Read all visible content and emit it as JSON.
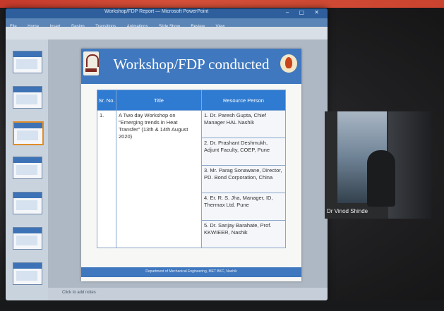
{
  "window": {
    "title_text": "Workshop/FDP Report — Microsoft PowerPoint",
    "ribbon_tabs": [
      "File",
      "Home",
      "Insert",
      "Design",
      "Transitions",
      "Animations",
      "Slide Show",
      "Review",
      "View"
    ],
    "controls": "–  ▢  ✕"
  },
  "slide": {
    "title": "Workshop/FDP conducted",
    "table": {
      "headers": [
        "Sr. No.",
        "Title",
        "Resource Person"
      ],
      "sr_no": "1.",
      "title_cell": "A Two day Workshop on \"Emerging trends in Heat Transfer\" (13th & 14th August 2020)",
      "resource_persons": [
        "1. Dr. Paresh Gupta, Chief Manager HAL Nashik",
        "2. Dr. Prashant Deshmukh, Adjunt Faculty, COEP, Pune",
        "3. Mr. Parag Sonawane, Director, PD. Bond Corporation, China",
        "4. Er. R. S. Jha, Manager, ID, Thermax Ltd. Pune",
        "5. Dr. Sanjay Barahate, Prof. KKWIEER, Nashik"
      ]
    },
    "footer": "Department of Mechanical Engineering, MET BKC, Nashik"
  },
  "status": {
    "notes_placeholder": "Click to add notes"
  },
  "participant": {
    "name": "Dr Vinod Shinde"
  }
}
